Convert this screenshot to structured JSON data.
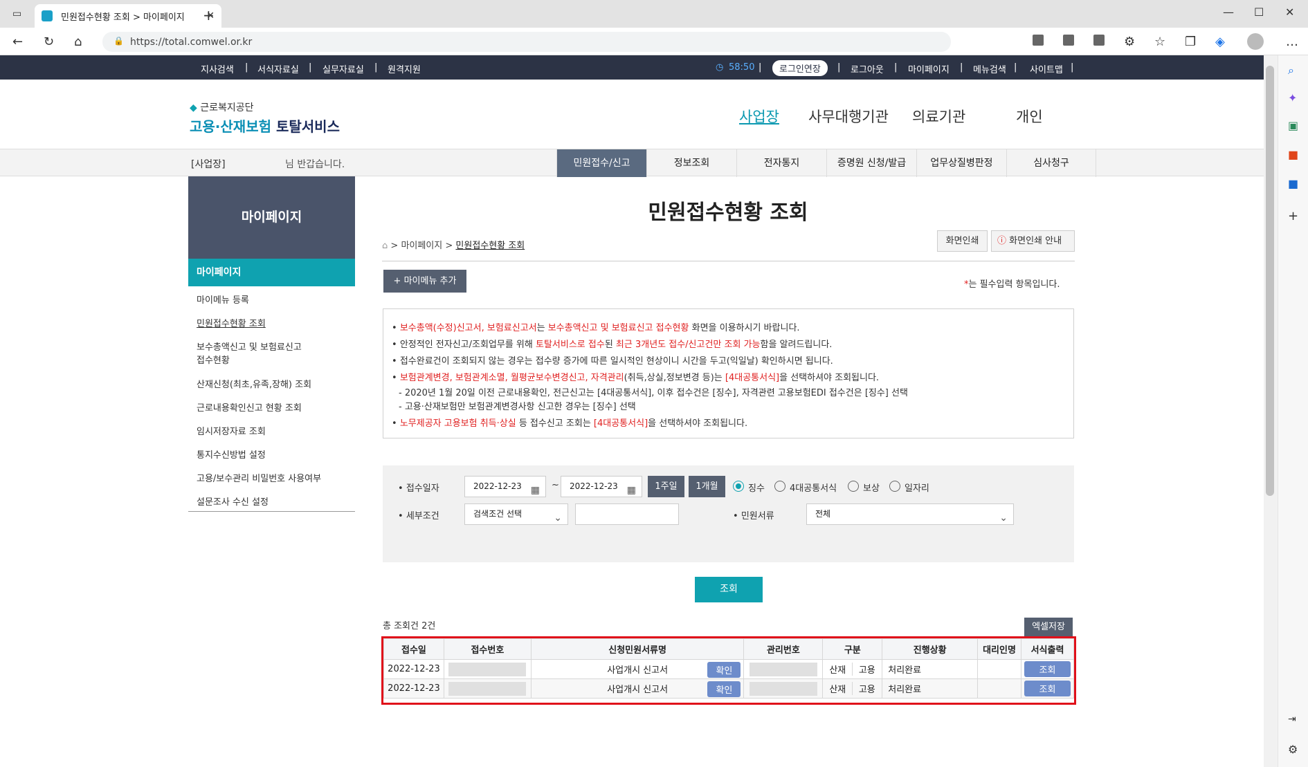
{
  "browser": {
    "tab_title": "민원접수현황 조회 > 마이페이지",
    "url": "https://total.comwel.or.kr"
  },
  "topbar": {
    "left": [
      "지사검색",
      "서식자료실",
      "실무자료실",
      "원격지원"
    ],
    "timer": "58:50",
    "extend": "로그인연장",
    "right": [
      "로그아웃",
      "마이페이지",
      "메뉴검색",
      "사이트맵"
    ]
  },
  "header": {
    "logo_small": "근로복지공단",
    "logo_big": "고용·산재보험",
    "logo_big2": "토탈서비스",
    "nav": [
      "사업장",
      "사무대행기관",
      "의료기관",
      "개인"
    ]
  },
  "gnb": {
    "greeting_prefix": "[사업장]",
    "greeting_suffix": "님 반갑습니다.",
    "items": [
      "민원접수/신고",
      "정보조회",
      "전자통지",
      "증명원 신청/발급",
      "업무상질병판정",
      "심사청구"
    ]
  },
  "lnb": {
    "title": "마이페이지",
    "selected": "마이페이지",
    "items": [
      "마이메뉴 등록",
      "민원접수현황 조회",
      "보수총액신고 및 보험료신고",
      "접수현황",
      "산재신청(최초,유족,장해) 조회",
      "근로내용확인신고 현황 조회",
      "임시저장자료 조회",
      "통지수신방법 설정",
      "고용/보수관리 비밀번호 사용여부",
      "설문조사 수신 설정"
    ]
  },
  "page": {
    "title": "민원접수현황 조회",
    "breadcrumb": [
      "마이페이지",
      "민원접수현황 조회"
    ],
    "print": "화면인쇄",
    "print_guide": "화면인쇄 안내",
    "add_menu": "마이메뉴 추가",
    "required_note": "는 필수입력 항목입니다."
  },
  "notice": {
    "l1a": "보수총액(수정)신고서, 보험료신고서",
    "l1b": "는 ",
    "l1c": "보수총액신고 및 보험료신고 접수현황",
    "l1d": " 화면을 이용하시기 바랍니다.",
    "l2a": "안정적인 전자신고/조회업무를 위해 ",
    "l2b": "토탈서비스로 접수",
    "l2c": "된 ",
    "l2d": "최근 3개년도 접수/신고건만 조회 가능",
    "l2e": "함을 알려드립니다.",
    "l3": "접수완료건이 조회되지 않는 경우는 접수량 증가에 따른 일시적인 현상이니 시간을 두고(익일날) 확인하시면 됩니다.",
    "l4a": "보험관계변경, 보험관계소멸, 월평균보수변경신고, 자격관리",
    "l4b": "(취득,상실,정보변경 등)는 ",
    "l4c": "[4대공통서식]",
    "l4d": "을 선택하셔야 조회됩니다.",
    "l5": "- 2020년 1월 20일 이전 근로내용확인, 전근신고는 [4대공통서식], 이후 접수건은 [징수], 자격관련 고용보험EDI 접수건은 [징수] 선택",
    "l6": "- 고용·산재보험만 보험관계변경사항 신고한 경우는 [징수] 선택",
    "l7a": "노무제공자 고용보험 취득·상실",
    "l7b": " 등 접수신고 조회는 ",
    "l7c": "[4대공통서식]",
    "l7d": "을 선택하셔야 조회됩니다."
  },
  "search": {
    "date_label": "접수일자",
    "date_from": "2022-12-23",
    "date_to": "2022-12-23",
    "week": "1주일",
    "month": "1개월",
    "radios": [
      "징수",
      "4대공통서식",
      "보상",
      "일자리"
    ],
    "cond_label": "세부조건",
    "cond_value": "검색조건 선택",
    "doc_label": "민원서류",
    "doc_value": "전체",
    "submit": "조회"
  },
  "results": {
    "count": "총 조회건 2건",
    "excel": "엑셀저장",
    "headers": [
      "접수일",
      "접수번호",
      "신청민원서류명",
      "관리번호",
      "구분",
      "진행상황",
      "대리인명",
      "서식출력"
    ],
    "rows": [
      {
        "date": "2022-12-23",
        "doc": "사업개시 신고서",
        "confirm": "확인",
        "kind1": "산재",
        "kind2": "고용",
        "status": "처리완료",
        "print": "조회"
      },
      {
        "date": "2022-12-23",
        "doc": "사업개시 신고서",
        "confirm": "확인",
        "kind1": "산재",
        "kind2": "고용",
        "status": "처리완료",
        "print": "조회"
      }
    ]
  },
  "colors": {
    "accent": "#0fa2b0",
    "dark": "#2c3345",
    "highlight": "#e0101a"
  }
}
